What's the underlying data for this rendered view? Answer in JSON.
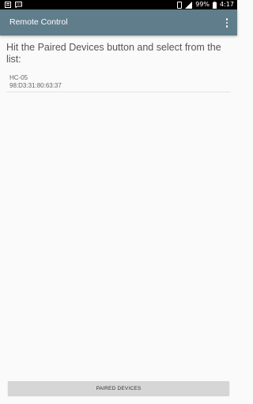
{
  "status_bar": {
    "battery_percent": "99%",
    "time": "4:17",
    "left_icons": [
      "notification-icon",
      "message-icon"
    ],
    "right_icons": [
      "phone-icon",
      "signal-icon",
      "battery-icon"
    ]
  },
  "app_bar": {
    "title": "Remote Control",
    "menu_icon": "overflow-menu-icon",
    "color": "#607d8b"
  },
  "main": {
    "instruction": "Hit the Paired Devices button and select from the list:",
    "devices": [
      {
        "name": "HC-05",
        "address": "98:D3:31:80:63:37"
      }
    ]
  },
  "footer": {
    "button_label": "PAIRED DEVICES"
  }
}
